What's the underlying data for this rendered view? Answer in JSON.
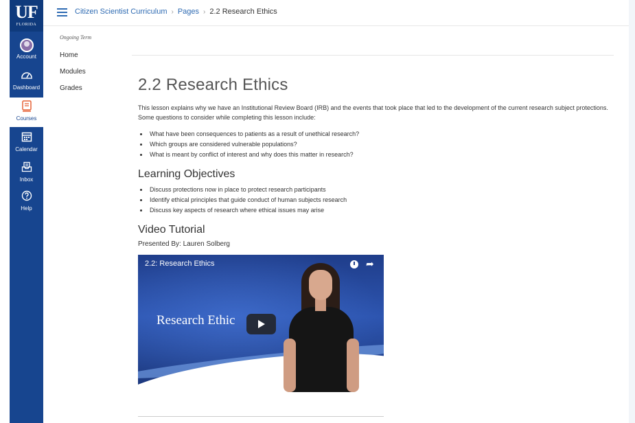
{
  "brand": {
    "logo_main": "UF",
    "logo_sub": "FLORIDA",
    "nav_color": "#17458f",
    "link_color": "#2d6ab2",
    "active_icon_color": "#e66135"
  },
  "global_nav": [
    {
      "label": "Account",
      "icon": "account-avatar"
    },
    {
      "label": "Dashboard",
      "icon": "dashboard-icon"
    },
    {
      "label": "Courses",
      "icon": "courses-icon",
      "active": true
    },
    {
      "label": "Calendar",
      "icon": "calendar-icon"
    },
    {
      "label": "Inbox",
      "icon": "inbox-icon"
    },
    {
      "label": "Help",
      "icon": "help-icon"
    }
  ],
  "breadcrumbs": [
    "Citizen Scientist Curriculum",
    "Pages",
    "2.2 Research Ethics"
  ],
  "course_nav": {
    "term": "Ongoing Term",
    "links": [
      "Home",
      "Modules",
      "Grades"
    ]
  },
  "page": {
    "title": "2.2 Research Ethics",
    "intro": "This lesson explains why we have an Institutional Review Board (IRB) and the events that took place that led to the development of the current research subject protections. Some questions to consider while completing this lesson include:",
    "questions": [
      "What have been consequences to patients as a result of unethical research?",
      "Which groups are considered vulnerable populations?",
      "What is meant by conflict of interest and why does this matter in research?"
    ],
    "objectives_heading": "Learning Objectives",
    "objectives": [
      "Discuss protections now in place to protect research participants",
      "Identify ethical principles that guide conduct of human subjects research",
      "Discuss key aspects of research where ethical issues may arise"
    ],
    "video_heading": "Video Tutorial",
    "presenter": "Presented By: Lauren Solberg"
  },
  "video": {
    "title": "2.2: Research Ethics",
    "slide_text": "Research Ethic"
  }
}
